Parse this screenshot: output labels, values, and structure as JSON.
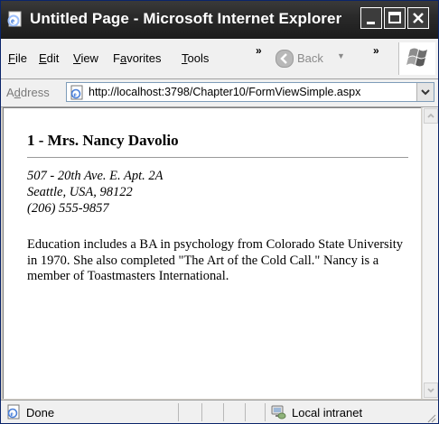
{
  "window": {
    "title": "Untitled Page - Microsoft Internet Explorer"
  },
  "menu": {
    "file": "ile",
    "file_key": "F",
    "edit": "dit",
    "edit_key": "E",
    "view": "iew",
    "view_key": "V",
    "favorites_pre": "F",
    "favorites_key": "a",
    "favorites_post": "vorites",
    "tools": "ools",
    "tools_key": "T",
    "overflow": "»",
    "back_label": "Back",
    "back_caret": "▼",
    "overflow2": "»"
  },
  "address": {
    "label_pre": "A",
    "label_key": "d",
    "label_post": "dress",
    "url": "http://localhost:3798/Chapter10/FormViewSimple.aspx"
  },
  "page": {
    "heading": "1 - Mrs. Nancy Davolio",
    "address_line1": "507 - 20th Ave. E. Apt. 2A",
    "address_line2": "Seattle, USA, 98122",
    "phone": "(206) 555-9857",
    "notes": "Education includes a BA in psychology from Colorado State University in 1970. She also completed \"The Art of the Cold Call.\" Nancy is a member of Toastmasters International."
  },
  "status": {
    "text": "Done",
    "zone": "Local intranet"
  },
  "icons": {
    "app": "ie-page-icon",
    "minimize": "minimize-icon",
    "maximize": "maximize-icon",
    "close": "close-icon",
    "back": "back-arrow-icon",
    "windows_logo": "windows-logo-icon",
    "address_page": "page-icon",
    "dropdown": "chevron-down-icon",
    "scroll_up": "scroll-up-icon",
    "scroll_down": "scroll-down-icon",
    "status_page": "page-icon",
    "zone": "intranet-icon"
  },
  "colors": {
    "titlebar": "#1c1c1c",
    "content_bg": "#ffffff",
    "chrome_bg": "#f0f0f0"
  }
}
